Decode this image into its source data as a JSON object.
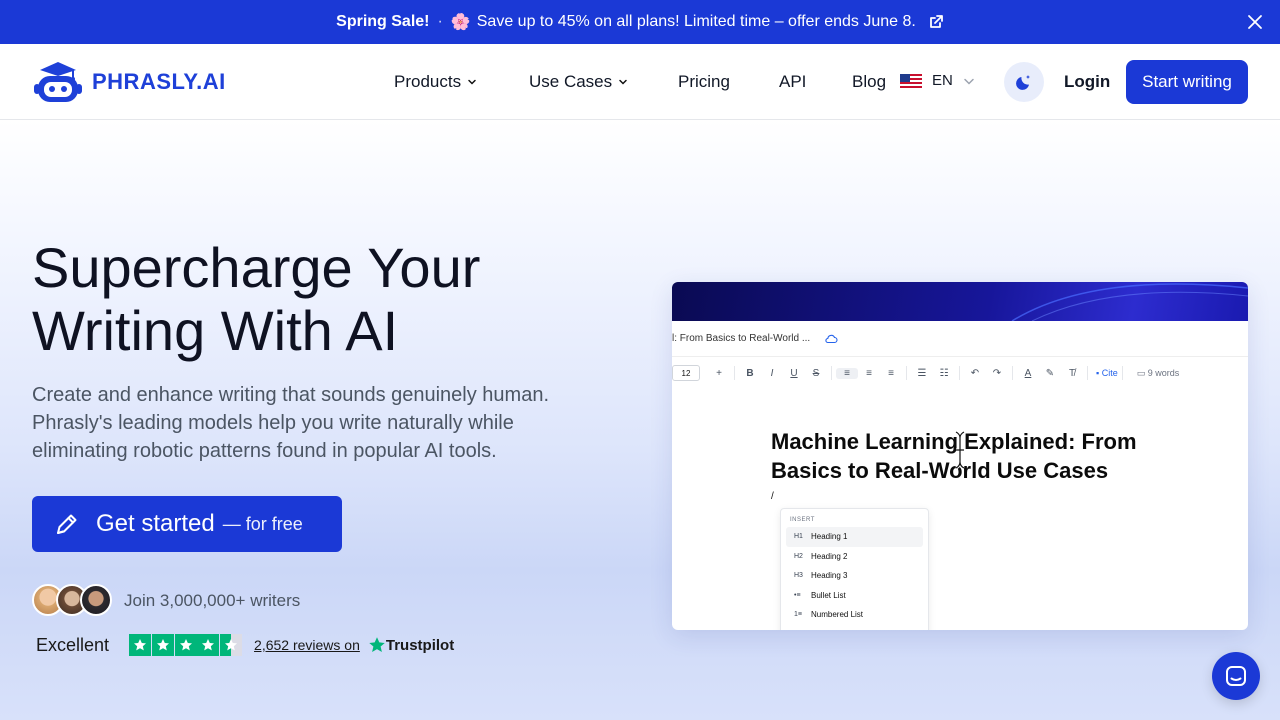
{
  "promo": {
    "bold": "Spring Sale!",
    "separator": "·",
    "emoji": "🌸",
    "message": "Save up to 45% on all plans! Limited time – offer ends June 8."
  },
  "nav": {
    "logo_text": "PHRASLY.AI",
    "links": [
      {
        "label": "Products",
        "has_dropdown": true
      },
      {
        "label": "Use Cases",
        "has_dropdown": true
      },
      {
        "label": "Pricing",
        "has_dropdown": false
      },
      {
        "label": "API",
        "has_dropdown": false
      },
      {
        "label": "Blog",
        "has_dropdown": false
      }
    ],
    "language": "EN",
    "login": "Login",
    "start_writing": "Start writing"
  },
  "hero": {
    "headline": "Supercharge Your Writing With AI",
    "subtext": "Create and enhance writing that sounds genuinely human. Phrasly's leading models help you write naturally while eliminating robotic patterns found in popular AI tools.",
    "cta_main": "Get started",
    "cta_sub": "— for free",
    "join_text": "Join 3,000,000+ writers",
    "trustpilot": {
      "rating_word": "Excellent",
      "stars": 4.5,
      "reviews_text": "2,652 reviews on",
      "brand": "Trustpilot"
    }
  },
  "editor": {
    "doc_name": "l: From Basics to Real-World ...",
    "font_size": "12",
    "cite_label": "Cite",
    "word_count": "9 words",
    "doc_title": "Machine Learning Explained: From Basics to Real-World Use Cases",
    "slash": "/",
    "insert_label": "INSERT",
    "menu_items": [
      {
        "icon": "H1",
        "label": "Heading 1"
      },
      {
        "icon": "H2",
        "label": "Heading 2"
      },
      {
        "icon": "H3",
        "label": "Heading 3"
      },
      {
        "icon": "•≡",
        "label": "Bullet List"
      },
      {
        "icon": "1≡",
        "label": "Numbered List"
      }
    ]
  },
  "colors": {
    "brand_blue": "#1b39d6",
    "trustpilot_green": "#00b67a"
  }
}
